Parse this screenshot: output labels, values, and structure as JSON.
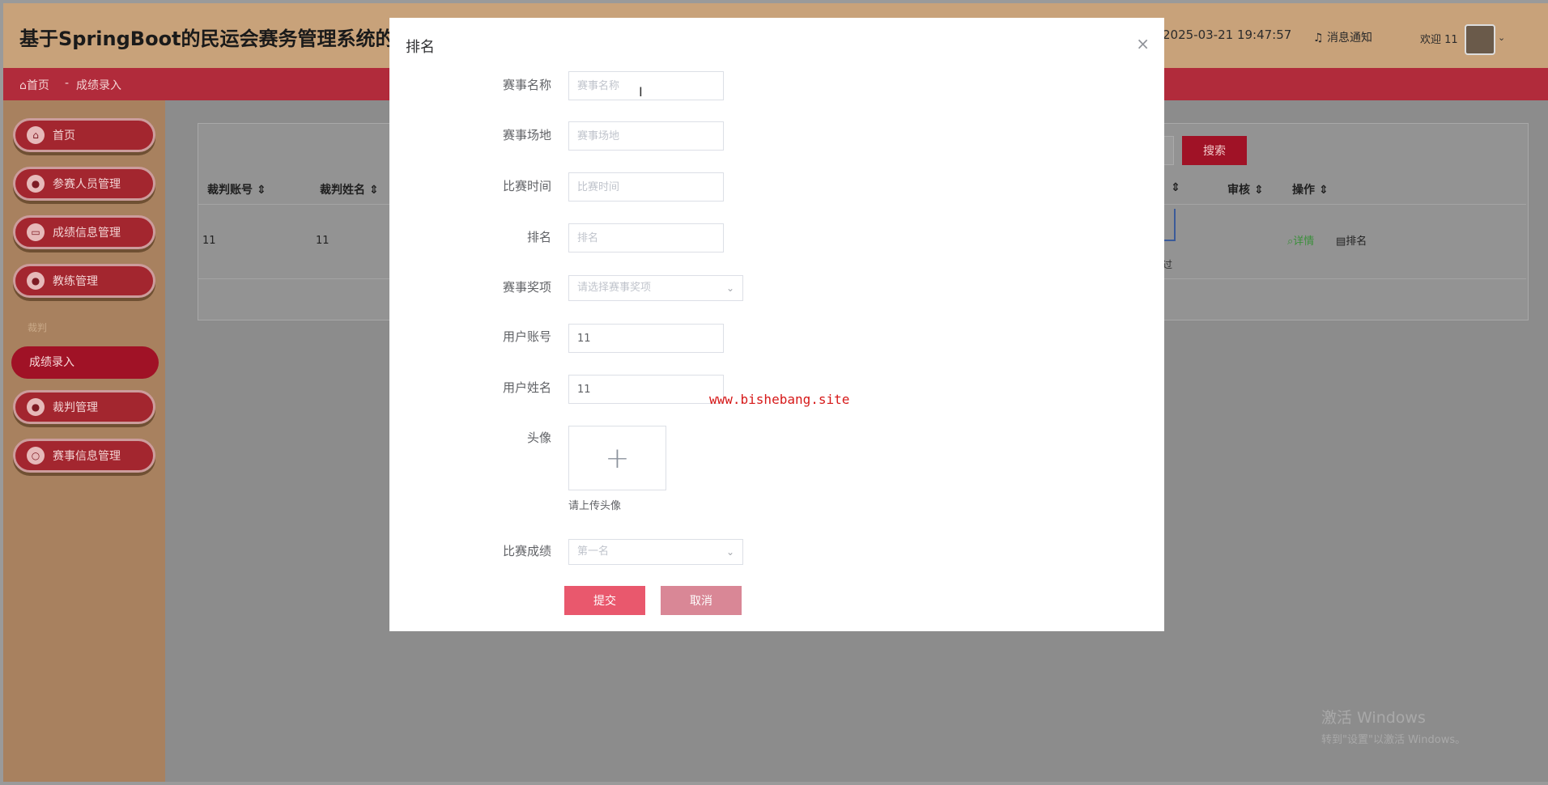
{
  "header": {
    "title": "基于SpringBoot的民运会赛务管理系统的设",
    "time": "2025-03-21 19:47:57",
    "notice": "消息通知",
    "welcome": "欢迎 11"
  },
  "breadcrumb": {
    "home": "首页",
    "separator": "-",
    "current": "成绩录入"
  },
  "sidebar": {
    "items": [
      {
        "label": "首页"
      },
      {
        "label": "参赛人员管理"
      },
      {
        "label": "成绩信息管理"
      },
      {
        "label": "教练管理"
      }
    ],
    "group_label": "裁判",
    "active_item": "成绩录入",
    "items_after": [
      {
        "label": "裁判管理"
      },
      {
        "label": "赛事信息管理"
      }
    ]
  },
  "table": {
    "search_button": "搜索",
    "headers": [
      "裁判账号",
      "裁判姓名",
      "审核",
      "操作"
    ],
    "row": {
      "account": "11",
      "name": "11",
      "image_caption": "过",
      "op_detail": "详情",
      "op_rank": "排名"
    }
  },
  "modal": {
    "title": "排名",
    "close": "×",
    "fields": [
      {
        "label": "赛事名称",
        "placeholder": "赛事名称",
        "value": ""
      },
      {
        "label": "赛事场地",
        "placeholder": "赛事场地",
        "value": ""
      },
      {
        "label": "比赛时间",
        "placeholder": "比赛时间",
        "value": ""
      },
      {
        "label": "排名",
        "placeholder": "排名",
        "value": ""
      }
    ],
    "award": {
      "label": "赛事奖项",
      "placeholder": "请选择赛事奖项"
    },
    "user_account": {
      "label": "用户账号",
      "value": "11"
    },
    "user_name": {
      "label": "用户姓名",
      "value": "11"
    },
    "avatar": {
      "label": "头像",
      "plus": "+",
      "tip": "请上传头像"
    },
    "result": {
      "label": "比赛成绩",
      "value": "第一名"
    },
    "submit": "提交",
    "cancel": "取消"
  },
  "watermark": "www.bishebang.site",
  "activate_windows": {
    "line1": "激活 Windows",
    "line2": "转到\"设置\"以激活 Windows。"
  }
}
